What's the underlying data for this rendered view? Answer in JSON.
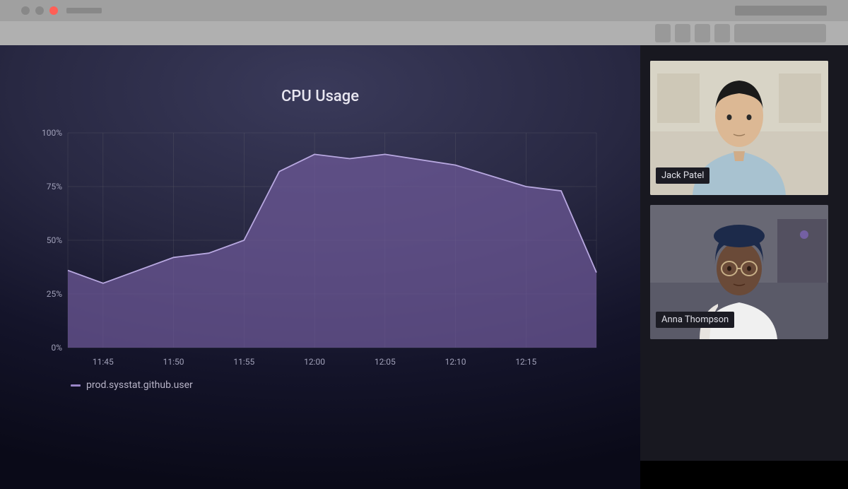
{
  "chart_data": {
    "type": "area",
    "title": "CPU Usage",
    "ylabel": "",
    "xlabel": "",
    "ylim": [
      0,
      100
    ],
    "y_ticks": [
      0,
      25,
      50,
      75,
      100
    ],
    "y_tick_labels": [
      "0%",
      "25%",
      "50%",
      "75%",
      "100%"
    ],
    "x_categories": [
      "11:45",
      "11:50",
      "11:55",
      "12:00",
      "12:05",
      "12:10",
      "12:15"
    ],
    "series": [
      {
        "name": "prod.sysstat.github.user",
        "color": "#9a86c8",
        "values_x_minutes": [
          -2.5,
          0,
          5,
          7.5,
          10,
          12.5,
          15,
          17.5,
          20,
          25,
          30,
          32.5,
          35
        ],
        "values_y_pct": [
          36,
          30,
          42,
          44,
          50,
          82,
          90,
          88,
          90,
          85,
          75,
          73,
          35
        ]
      }
    ]
  },
  "legend": {
    "label": "prod.sysstat.github.user"
  },
  "video": {
    "tiles": [
      {
        "name": "Jack Patel"
      },
      {
        "name": "Anna Thompson"
      }
    ]
  }
}
